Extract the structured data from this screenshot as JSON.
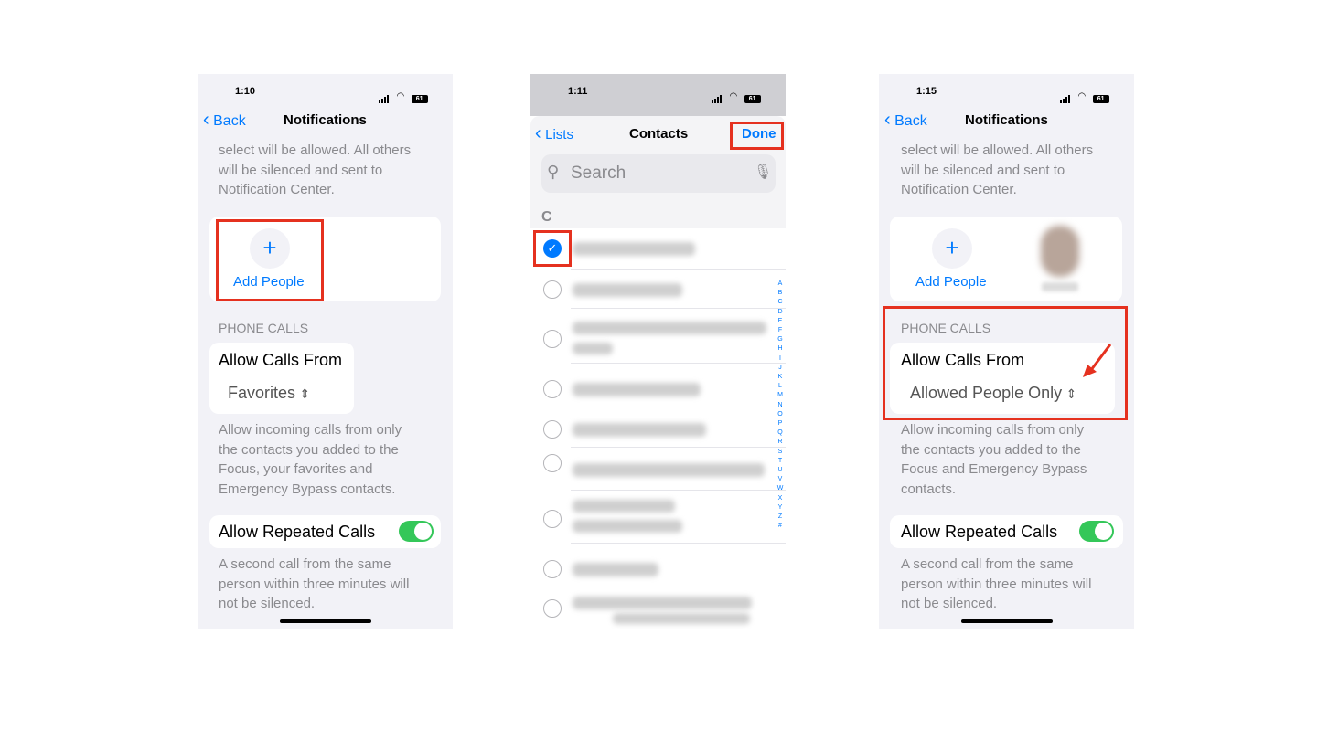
{
  "screen1": {
    "time": "1:10",
    "battery": "61",
    "back_label": "Back",
    "title": "Notifications",
    "intro_lines": [
      "select will be allowed. All others",
      "will be silenced and sent to",
      "Notification Center."
    ],
    "add_people": "Add People",
    "section_header": "PHONE CALLS",
    "allow_calls_label": "Allow Calls From",
    "allow_calls_value": "Favorites",
    "calls_desc_lines": [
      "Allow incoming calls from only",
      "the contacts you added to the",
      "Focus, your favorites and",
      "Emergency Bypass contacts."
    ],
    "repeated_label": "Allow Repeated Calls",
    "repeated_on": true,
    "repeated_desc_lines": [
      "A second call from the same",
      "person within three minutes will",
      "not be silenced."
    ]
  },
  "screen2": {
    "time": "1:11",
    "battery": "61",
    "back_label": "Lists",
    "title": "Contacts",
    "done_label": "Done",
    "search_placeholder": "Search",
    "section_letter": "C",
    "index_letters": [
      "A",
      "B",
      "C",
      "D",
      "E",
      "F",
      "G",
      "H",
      "I",
      "J",
      "K",
      "L",
      "M",
      "N",
      "O",
      "P",
      "Q",
      "R",
      "S",
      "T",
      "U",
      "V",
      "W",
      "X",
      "Y",
      "Z",
      "#"
    ]
  },
  "screen3": {
    "time": "1:15",
    "battery": "61",
    "back_label": "Back",
    "title": "Notifications",
    "intro_lines": [
      "select will be allowed. All others",
      "will be silenced and sent to",
      "Notification Center."
    ],
    "add_people": "Add People",
    "section_header": "PHONE CALLS",
    "allow_calls_label": "Allow Calls From",
    "allow_calls_value": "Allowed People Only",
    "calls_desc_lines": [
      "Allow incoming calls from only",
      "the contacts you added to the",
      "Focus and Emergency Bypass",
      "contacts."
    ],
    "repeated_label": "Allow Repeated Calls",
    "repeated_on": true,
    "repeated_desc_lines": [
      "A second call from the same",
      "person within three minutes will",
      "not be silenced."
    ]
  },
  "colors": {
    "accent": "#007aff",
    "highlight": "#e5311f",
    "toggle_on": "#34c759",
    "background": "#f2f2f7"
  }
}
